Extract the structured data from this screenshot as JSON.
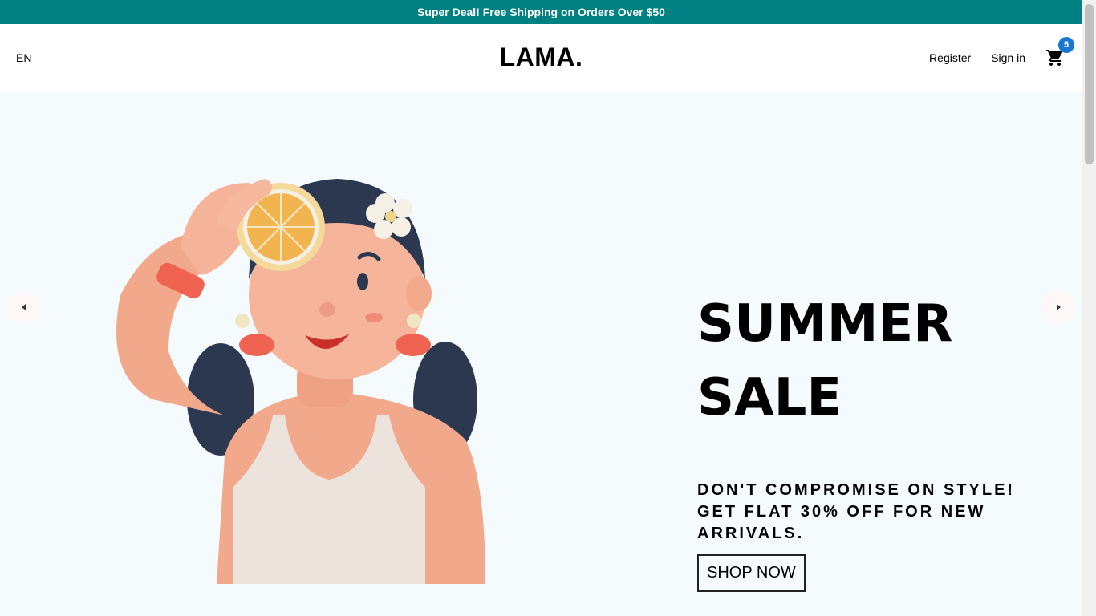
{
  "announcement": {
    "text": "Super Deal! Free Shipping on Orders Over $50"
  },
  "nav": {
    "language": "EN",
    "logo": "LAMA.",
    "register": "Register",
    "signin": "Sign in",
    "cart_count": "5"
  },
  "hero": {
    "title": "SUMMER SALE",
    "description": "DON'T COMPROMISE ON STYLE! GET FLAT 30% OFF FOR NEW ARRIVALS.",
    "button": "SHOP NOW"
  },
  "colors": {
    "announcement_bg": "#008080",
    "hero_bg": "#f5fafd",
    "badge": "#1976d2"
  }
}
